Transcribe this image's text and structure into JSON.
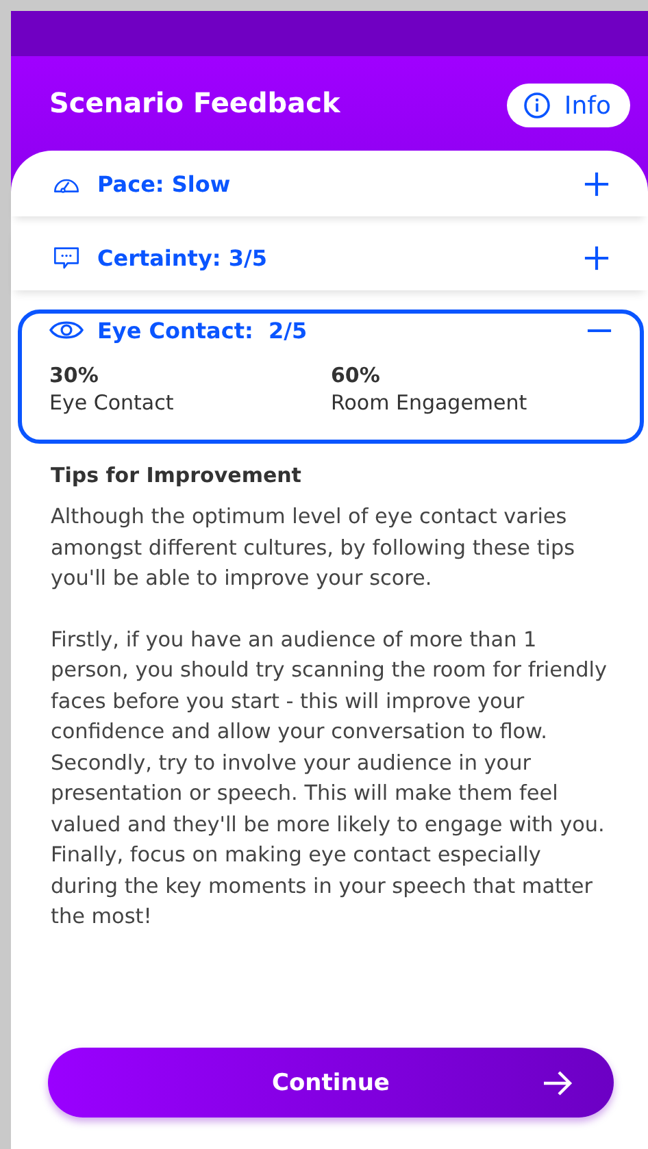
{
  "header": {
    "title": "Scenario Feedback",
    "info_button": "Info"
  },
  "sections": [
    {
      "label": "Pace: Slow",
      "expanded": false
    },
    {
      "label": "Certainty: 3/5",
      "expanded": false
    },
    {
      "label": "Eye Contact:  2/5",
      "expanded": true,
      "stats": [
        {
          "value": "30%",
          "label": "Eye Contact"
        },
        {
          "value": "60%",
          "label": "Room Engagement"
        }
      ]
    }
  ],
  "tips": {
    "title": "Tips for Improvement",
    "paragraphs": [
      "Although the optimum level of eye contact varies amongst different cultures, by following these tips you'll be able to improve your score.",
      "Firstly, if you have an audience of more than 1 person, you should try scanning the room for friendly faces before you start - this will improve your confidence and allow your conversation to flow. Secondly, try to involve your audience in your presentation or speech. This will make them feel valued and they'll be more likely to engage with you. Finally, focus on making eye contact especially during the key moments in your speech that matter the most!"
    ]
  },
  "continue_button": "Continue"
}
